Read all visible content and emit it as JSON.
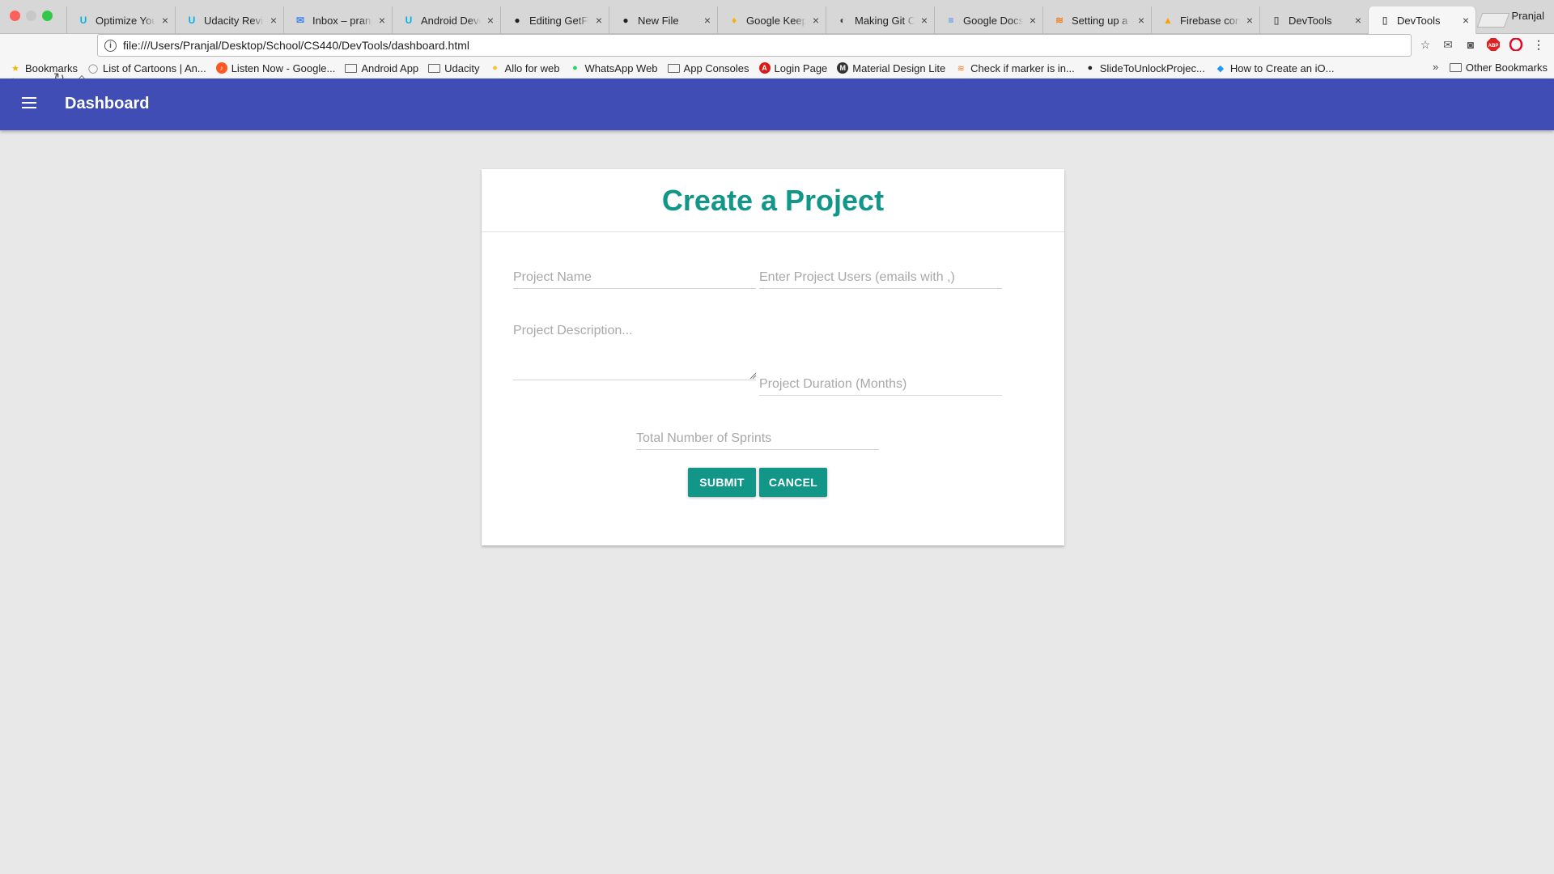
{
  "browser": {
    "tabs": [
      {
        "title": "Optimize Your",
        "icon": "udacity-icon",
        "color": "#02b3e4",
        "glyph": "U"
      },
      {
        "title": "Udacity Review",
        "icon": "udacity-icon",
        "color": "#02b3e4",
        "glyph": "U"
      },
      {
        "title": "Inbox – pranjal",
        "icon": "inbox-icon",
        "color": "#4285f4",
        "glyph": "✉"
      },
      {
        "title": "Android Devel",
        "icon": "udacity-icon",
        "color": "#02b3e4",
        "glyph": "U"
      },
      {
        "title": "Editing GetFit",
        "icon": "github-icon",
        "color": "#222222",
        "glyph": "●"
      },
      {
        "title": "New File",
        "icon": "github-icon",
        "color": "#222222",
        "glyph": "●"
      },
      {
        "title": "Google Keep",
        "icon": "keep-icon",
        "color": "#f4b400",
        "glyph": "♦"
      },
      {
        "title": "Making Git Co",
        "icon": "git-icon",
        "color": "#444444",
        "glyph": "◐"
      },
      {
        "title": "Google Docs",
        "icon": "docs-icon",
        "color": "#4285f4",
        "glyph": "≡"
      },
      {
        "title": "Setting up a g",
        "icon": "stackoverflow-icon",
        "color": "#f48024",
        "glyph": "≋"
      },
      {
        "title": "Firebase cons",
        "icon": "firebase-icon",
        "color": "#ffa000",
        "glyph": "▲"
      },
      {
        "title": "DevTools",
        "icon": "page-icon",
        "color": "#666666",
        "glyph": "▯"
      },
      {
        "title": "DevTools",
        "icon": "page-icon",
        "color": "#666666",
        "glyph": "▯",
        "active": true
      }
    ],
    "profile_name": "Pranjal",
    "url": "file:///Users/Pranjal/Desktop/School/CS440/DevTools/dashboard.html",
    "bookmarks": [
      {
        "label": "Bookmarks",
        "icon": "star-icon"
      },
      {
        "label": "List of Cartoons | An...",
        "icon": "globe-icon"
      },
      {
        "label": "Listen Now - Google...",
        "icon": "music-icon"
      },
      {
        "label": "Android App",
        "icon": "folder-icon"
      },
      {
        "label": "Udacity",
        "icon": "folder-icon"
      },
      {
        "label": "Allo for web",
        "icon": "allo-icon"
      },
      {
        "label": "WhatsApp Web",
        "icon": "whatsapp-icon"
      },
      {
        "label": "App Consoles",
        "icon": "folder-icon"
      },
      {
        "label": "Login Page",
        "icon": "angular-icon"
      },
      {
        "label": "Material Design Lite",
        "icon": "mdl-icon"
      },
      {
        "label": "Check if marker is in...",
        "icon": "stackoverflow-icon"
      },
      {
        "label": "SlideToUnlockProjec...",
        "icon": "github-icon"
      },
      {
        "label": "How to Create an iO...",
        "icon": "swift-icon"
      }
    ],
    "other_bookmarks": "Other Bookmarks",
    "overflow_chevron": "»"
  },
  "app": {
    "title": "Dashboard",
    "accent": "#3f4db4",
    "brand": "#119688"
  },
  "form": {
    "title": "Create a Project",
    "project_name_placeholder": "Project Name",
    "project_users_placeholder": "Enter Project Users (emails with ,)",
    "description_placeholder": "Project Description...",
    "duration_placeholder": "Project Duration (Months)",
    "sprints_placeholder": "Total Number of Sprints",
    "submit_label": "SUBMIT",
    "cancel_label": "CANCEL"
  }
}
